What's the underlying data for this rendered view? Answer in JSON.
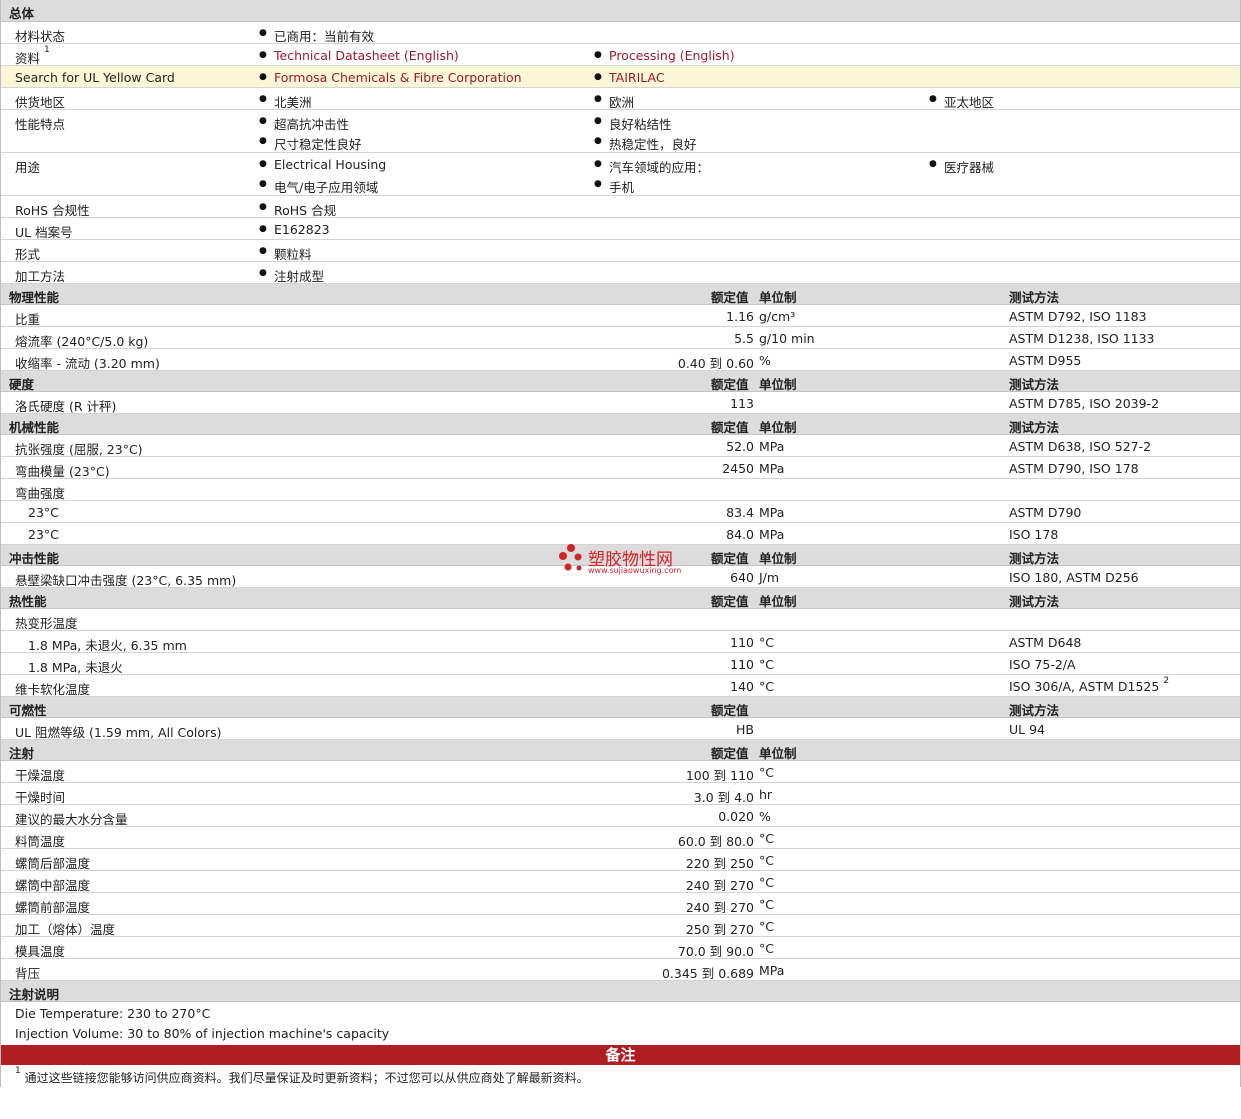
{
  "general": {
    "title": "总体",
    "material_status": {
      "label": "材料状态",
      "value": "已商用：当前有效"
    },
    "documents": {
      "label": "资料",
      "sup": "1",
      "link1": "Technical Datasheet (English)",
      "link2": "Processing (English)"
    },
    "ul_card": {
      "label": "Search for UL Yellow Card",
      "link1": "Formosa Chemicals & Fibre Corporation",
      "link2": "TAIRILAC"
    },
    "regions": {
      "label": "供货地区",
      "v1": "北美洲",
      "v2": "欧洲",
      "v3": "亚太地区"
    },
    "features": {
      "label": "性能特点",
      "v1": "超高抗冲击性",
      "v2": "良好粘结性",
      "v3": "尺寸稳定性良好",
      "v4": "热稳定性，良好"
    },
    "uses": {
      "label": "用途",
      "v1": "Electrical Housing",
      "v2": "汽车领域的应用：",
      "v3": "医疗器械",
      "v4": "电气/电子应用领域",
      "v5": "手机"
    },
    "rohs": {
      "label": "RoHS 合规性",
      "value": "RoHS 合规"
    },
    "ul_file": {
      "label": "UL 档案号",
      "value": "E162823"
    },
    "form": {
      "label": "形式",
      "value": "颗粒料"
    },
    "processing": {
      "label": "加工方法",
      "value": "注射成型"
    }
  },
  "headers": {
    "nominal": "额定值",
    "unit": "单位制",
    "method": "测试方法"
  },
  "physical": {
    "title": "物理性能",
    "rows": [
      {
        "label": "比重",
        "value": "1.16",
        "unit": "g/cm³",
        "method": "ASTM D792, ISO 1183"
      },
      {
        "label": "熔流率  (240°C/5.0 kg)",
        "value": "5.5",
        "unit": "g/10 min",
        "method": "ASTM D1238, ISO 1133"
      },
      {
        "label": "收缩率  - 流动  (3.20 mm)",
        "value": "0.40 到  0.60",
        "unit": "%",
        "method": "ASTM D955"
      }
    ]
  },
  "hardness": {
    "title": "硬度",
    "rows": [
      {
        "label": "洛氏硬度  (R 计秤)",
        "value": "113",
        "unit": "",
        "method": "ASTM D785, ISO 2039-2"
      }
    ]
  },
  "mechanical": {
    "title": "机械性能",
    "r1": {
      "label": "抗张强度  (屈服, 23°C)",
      "value": "52.0",
      "unit": "MPa",
      "method": "ASTM D638, ISO 527-2"
    },
    "r2": {
      "label": "弯曲模量  (23°C)",
      "value": "2450",
      "unit": "MPa",
      "method": "ASTM D790, ISO 178"
    },
    "r3": {
      "label": "弯曲强度"
    },
    "r4": {
      "label": "23°C",
      "value": "83.4",
      "unit": "MPa",
      "method": "ASTM D790"
    },
    "r5": {
      "label": "23°C",
      "value": "84.0",
      "unit": "MPa",
      "method": "ISO 178"
    }
  },
  "impact": {
    "title": "冲击性能",
    "rows": [
      {
        "label": "悬壁梁缺口冲击强度  (23°C, 6.35 mm)",
        "value": "640",
        "unit": "J/m",
        "method": "ISO 180, ASTM D256"
      }
    ]
  },
  "thermal": {
    "title": "热性能",
    "r1": {
      "label": "热变形温度"
    },
    "r2": {
      "label": "1.8 MPa, 未退火, 6.35 mm",
      "value": "110",
      "unit": "°C",
      "method": "ASTM D648"
    },
    "r3": {
      "label": "1.8 MPa, 未退火",
      "value": "110",
      "unit": "°C",
      "method": "ISO 75-2/A"
    },
    "r4": {
      "label": "维卡软化温度",
      "value": "140",
      "unit": "°C",
      "method": "ISO 306/A, ASTM D1525",
      "sup": "2"
    }
  },
  "flammability": {
    "title": "可燃性",
    "row": {
      "label": "UL 阻燃等级  (1.59 mm, All Colors)",
      "value": "HB",
      "method": "UL 94"
    }
  },
  "injection": {
    "title": "注射",
    "rows": [
      {
        "label": "干燥温度",
        "value": "100 到  110",
        "unit": "°C"
      },
      {
        "label": "干燥时间",
        "value": "3.0 到  4.0",
        "unit": "hr"
      },
      {
        "label": "建议的最大水分含量",
        "value": "0.020",
        "unit": "%"
      },
      {
        "label": "料筒温度",
        "value": "60.0 到  80.0",
        "unit": "°C"
      },
      {
        "label": "螺筒后部温度",
        "value": "220 到  250",
        "unit": "°C"
      },
      {
        "label": "螺筒中部温度",
        "value": "240 到  270",
        "unit": "°C"
      },
      {
        "label": "螺筒前部温度",
        "value": "240 到  270",
        "unit": "°C"
      },
      {
        "label": "加工（熔体）温度",
        "value": "250 到  270",
        "unit": "°C"
      },
      {
        "label": "模具温度",
        "value": "70.0 到  90.0",
        "unit": "°C"
      },
      {
        "label": "背压",
        "value": "0.345 到  0.689",
        "unit": "MPa"
      }
    ]
  },
  "injection_notes": {
    "title": "注射说明",
    "line1": "Die Temperature: 230 to 270°C",
    "line2": "Injection Volume: 30 to 80% of injection machine's capacity"
  },
  "remarks": {
    "banner": "备注",
    "sup": "1",
    "text": "通过这些链接您能够访问供应商资料。我们尽量保证及时更新资料；不过您可以从供应商处了解最新资料。"
  },
  "watermark": {
    "text": "塑胶物性网",
    "url": "www.sujiaowuxing.com"
  }
}
